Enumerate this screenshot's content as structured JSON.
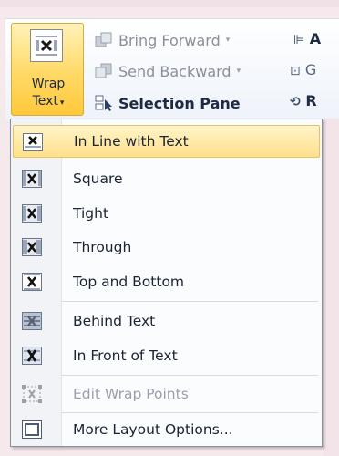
{
  "wrap_button": {
    "line1": "Wrap",
    "line2": "Text",
    "arrow": "▾",
    "icon": "wrap-text-icon"
  },
  "ribbon": {
    "bring_forward": "Bring Forward",
    "send_backward": "Send Backward",
    "selection_pane": "Selection Pane",
    "dropdown_glyph": "▾",
    "right_col": [
      "A",
      "G",
      "R"
    ]
  },
  "menu": {
    "items": [
      {
        "label": "In Line with Text",
        "icon": "inline-with-text-icon"
      },
      {
        "label": "Square",
        "icon": "square-wrap-icon"
      },
      {
        "label": "Tight",
        "icon": "tight-wrap-icon"
      },
      {
        "label": "Through",
        "icon": "through-wrap-icon"
      },
      {
        "label": "Top and Bottom",
        "icon": "top-bottom-wrap-icon"
      },
      {
        "label": "Behind Text",
        "icon": "behind-text-icon"
      },
      {
        "label": "In Front of Text",
        "icon": "in-front-text-icon"
      },
      {
        "label": "Edit Wrap Points",
        "icon": "edit-wrap-points-icon"
      },
      {
        "label": "More Layout Options...",
        "icon": "layout-options-icon"
      }
    ]
  },
  "colors": {
    "highlight": "#ffe08a",
    "disabled_text": "#9aa0ab",
    "accent": "#1e2a44"
  }
}
